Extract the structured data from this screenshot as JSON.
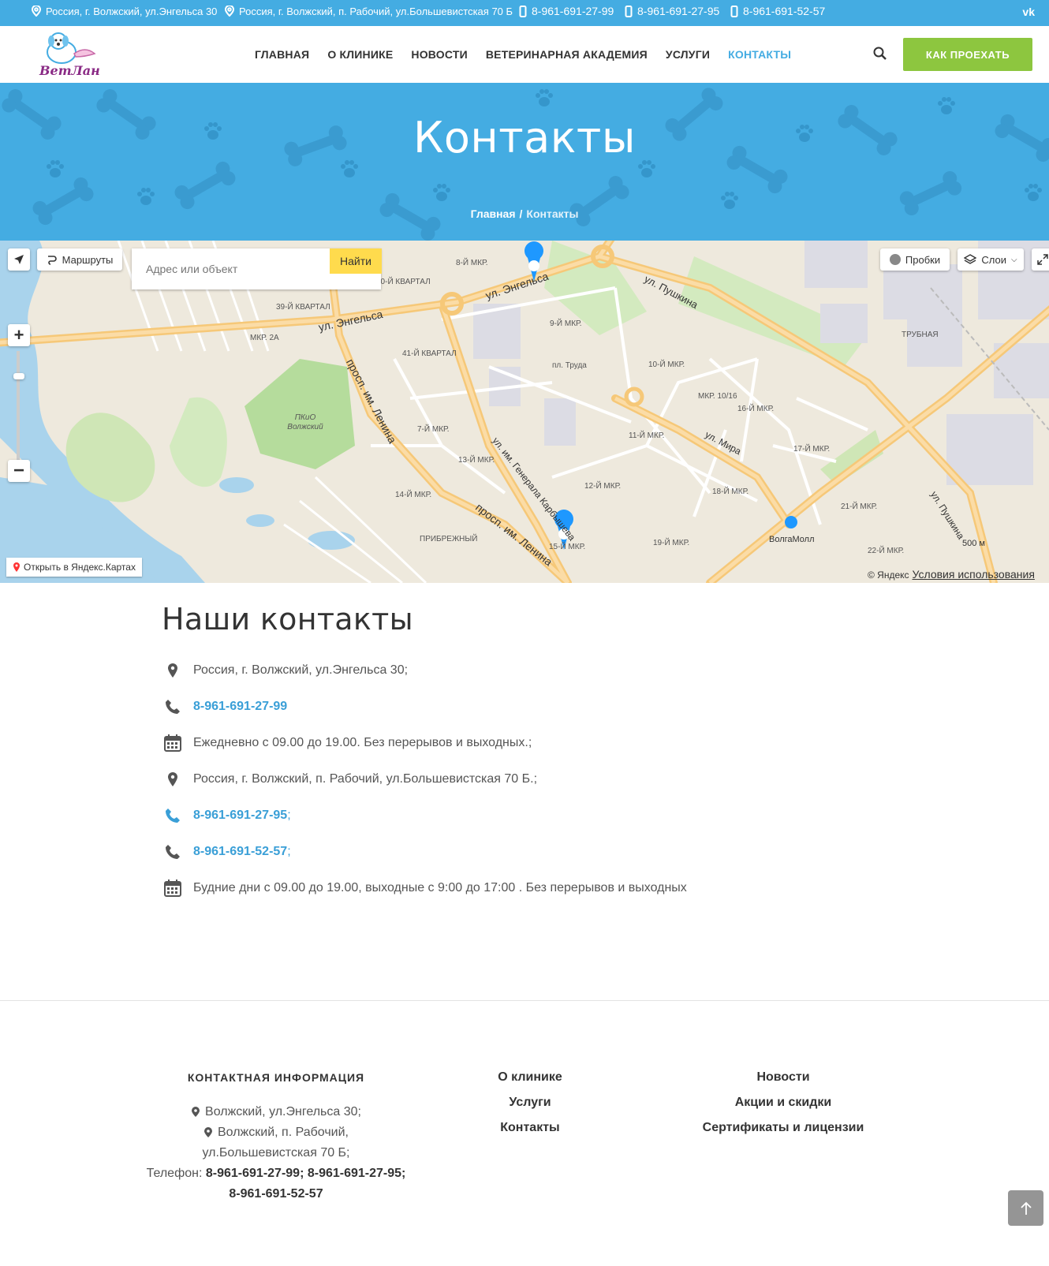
{
  "topbar": {
    "address1": "Россия, г. Волжский, ул.Энгельса 30",
    "address2": "Россия, г. Волжский, п. Рабочий, ул.Большевистская 70 Б",
    "phone1": "8-961-691-27-99",
    "phone2": "8-961-691-27-95",
    "phone3": "8-961-691-52-57",
    "vk_label": "vk"
  },
  "header": {
    "logo_text": "ВетЛана",
    "nav": [
      "ГЛАВНАЯ",
      "О КЛИНИКЕ",
      "НОВОСТИ",
      "ВЕТЕРИНАРНАЯ АКАДЕМИЯ",
      "УСЛУГИ",
      "КОНТАКТЫ"
    ],
    "route_button": "КАК ПРОЕХАТЬ"
  },
  "banner": {
    "title": "Контакты",
    "breadcrumb_home": "Главная",
    "breadcrumb_sep": "/",
    "breadcrumb_current": "Контакты"
  },
  "map": {
    "routes_label": "Маршруты",
    "search_placeholder": "Адрес или объект",
    "find_button": "Найти",
    "traffic_label": "Пробки",
    "layers_label": "Слои",
    "open_yandex": "Открыть в Яндекс.Картах",
    "copyright": "© Яндекс",
    "terms": "Условия использования",
    "scale": "500 м",
    "labels": [
      "8-Й МКР.",
      "40-Й КВАРТАЛ",
      "39-Й КВАРТАЛ",
      "МКР. 2А",
      "41-Й КВАРТАЛ",
      "9-Й МКР.",
      "пл. Труда",
      "10-Й МКР.",
      "МКР. 10/16",
      "16-Й МКР.",
      "ТРУБНАЯ",
      "7-Й МКР.",
      "13-Й МКР.",
      "11-Й МКР.",
      "17-Й МКР.",
      "12-Й МКР.",
      "18-Й МКР.",
      "14-Й МКР.",
      "21-Й МКР.",
      "ПРИБРЕЖНЫЙ",
      "15-Й МКР.",
      "19-Й МКР.",
      "ВолгаМолл",
      "22-Й МКР.",
      "ПКиО Волжский"
    ],
    "streets": [
      "ул. Энгельса",
      "ул. Энгельса",
      "ул. Пушкина",
      "просп. им. Ленина",
      "просп. им. Ленина",
      "ул. им. Генерала Карбышева",
      "ул. Мира",
      "ул. Пушкина"
    ]
  },
  "contacts": {
    "title": "Наши контакты",
    "items": [
      {
        "icon": "map-pin-icon",
        "text": "Россия, г. Волжский, ул.Энгельса 30;",
        "link": false
      },
      {
        "icon": "phone-icon",
        "text": "8-961-691-27-99",
        "link": true
      },
      {
        "icon": "calendar-icon",
        "text": "Ежедневно с 09.00 до 19.00. Без перерывов и выходных.;",
        "link": false
      },
      {
        "icon": "map-pin-icon",
        "text": "Россия, г. Волжский, п. Рабочий, ул.Большевистская 70 Б.;",
        "link": false
      },
      {
        "icon": "phone-icon",
        "text": "8-961-691-27-95",
        "suffix": ";",
        "link": true
      },
      {
        "icon": "phone-icon",
        "text": "8-961-691-52-57",
        "suffix": ";",
        "link": true
      },
      {
        "icon": "calendar-icon",
        "text": "Будние дни с 09.00 до 19.00, выходные с 9:00 до 17:00 . Без перерывов и выходных",
        "link": false
      }
    ]
  },
  "footer": {
    "info_title": "КОНТАКТНАЯ ИНФОРМАЦИЯ",
    "addr1": "Волжский, ул.Энгельса 30;",
    "addr2": "Волжский, п. Рабочий,",
    "addr2b": "ул.Большевистская 70 Б;",
    "phone_label": "Телефон:",
    "phone1": "8-961-691-27-99;",
    "phone2": "8-961-691-27-95;",
    "phone3": "8-961-691-52-57",
    "col2": [
      "О клинике",
      "Услуги",
      "Контакты"
    ],
    "col3": [
      "Новости",
      "Акции и скидки",
      "Сертификаты и лицензии"
    ]
  },
  "colors": {
    "brand_blue": "#44ace2",
    "accent_green": "#8dc63f",
    "link_blue": "#3a9fd7"
  }
}
